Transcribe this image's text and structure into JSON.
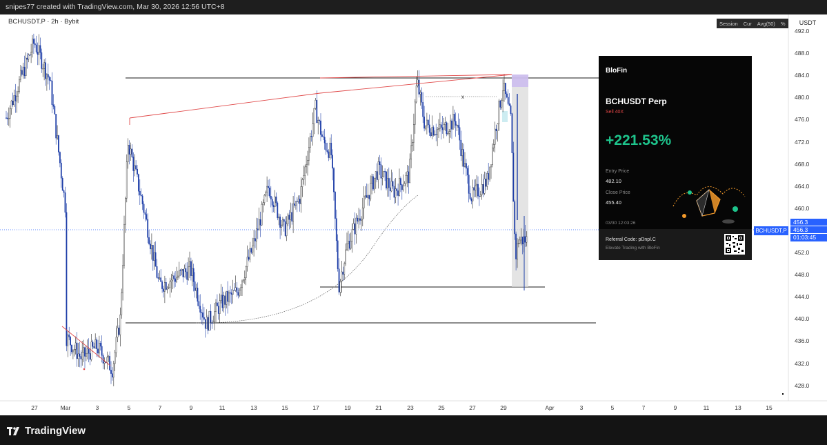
{
  "header": {
    "credit": "snipes77 created with TradingView.com, Mar 30, 2026 12:56 UTC+8"
  },
  "chart": {
    "symbol_label": "BCHUSDT.P · 2h · Bybit",
    "toolbar": [
      "Session",
      "Cur",
      "Avg(50)",
      "%"
    ],
    "currency": "USDT",
    "y_ticks": [
      "492.0",
      "488.0",
      "484.0",
      "480.0",
      "476.0",
      "472.0",
      "468.0",
      "464.0",
      "460.0",
      "456.0",
      "452.0",
      "448.0",
      "444.0",
      "440.0",
      "436.0",
      "432.0",
      "428.0"
    ],
    "x_ticks": [
      "27",
      "Mar",
      "3",
      "5",
      "7",
      "9",
      "11",
      "13",
      "15",
      "17",
      "19",
      "21",
      "23",
      "25",
      "27",
      "29",
      "Apr",
      "3",
      "5",
      "7",
      "9",
      "11",
      "13",
      "15"
    ],
    "last_price": "456.3",
    "last_price_repeat": "456.3",
    "countdown": "01:03:45",
    "symbol_tag": "BCHUSDT.P",
    "marker_label": "x",
    "colors": {
      "candle": "#2a2a2a",
      "up_line": "#1e3fa8",
      "trendline": "#e04a4a",
      "level": "#1a1a1a",
      "price": "#2962ff"
    }
  },
  "chart_data": {
    "type": "candlestick",
    "title": "BCHUSDT.P · 2h · Bybit",
    "x_axis_ticks": [
      "27",
      "Mar",
      "3",
      "5",
      "7",
      "9",
      "11",
      "13",
      "15",
      "17",
      "19",
      "21",
      "23",
      "25",
      "27",
      "29",
      "Apr",
      "3",
      "5",
      "7",
      "9",
      "11",
      "13",
      "15"
    ],
    "ylim": [
      426,
      494
    ],
    "path": [
      [
        "Feb 25",
        478
      ],
      [
        "Feb 26",
        492
      ],
      [
        "Feb 27",
        485
      ],
      [
        "Feb 28",
        462
      ],
      [
        "Mar 1",
        439
      ],
      [
        "Mar 2",
        435
      ],
      [
        "Mar 3",
        437
      ],
      [
        "Mar 4",
        433
      ],
      [
        "Mar 4.5",
        442
      ],
      [
        "Mar 5",
        474
      ],
      [
        "Mar 6",
        462
      ],
      [
        "Mar 7",
        448
      ],
      [
        "Mar 9",
        451
      ],
      [
        "Mar 10",
        441
      ],
      [
        "Mar 11",
        445
      ],
      [
        "Mar 12",
        447
      ],
      [
        "Mar 13",
        455
      ],
      [
        "Mar 14",
        466
      ],
      [
        "Mar 15",
        458
      ],
      [
        "Mar 16",
        464
      ],
      [
        "Mar 17",
        480
      ],
      [
        "Mar 17.5",
        474
      ],
      [
        "Mar 18",
        472
      ],
      [
        "Mar 18.5",
        448
      ],
      [
        "Mar 19",
        455
      ],
      [
        "Mar 20",
        462
      ],
      [
        "Mar 21",
        469
      ],
      [
        "Mar 22",
        465
      ],
      [
        "Mar 23",
        468
      ],
      [
        "Mar 23.5",
        485
      ],
      [
        "Mar 24",
        477
      ],
      [
        "Mar 25",
        476
      ],
      [
        "Mar 26",
        478
      ],
      [
        "Mar 26.5",
        470
      ],
      [
        "Mar 27",
        464
      ],
      [
        "Mar 28",
        467
      ],
      [
        "Mar 28.5",
        476
      ],
      [
        "Mar 29",
        484
      ],
      [
        "Mar 29.5",
        478
      ],
      [
        "Mar 29.8",
        453
      ],
      [
        "Mar 30",
        456.3
      ]
    ],
    "horizontal_levels": [
      483.6,
      446.2,
      439.4
    ],
    "last_price": 456.3,
    "colors": {
      "body": "#2a2a2a",
      "trendline": "#e04a4a",
      "level": "#1a1a1a",
      "price_line": "#2962ff"
    }
  },
  "promo_card": {
    "brand": "BloFin",
    "pair": "BCHUSDT Perp",
    "side": "Sell 40X",
    "pnl": "+221.53%",
    "entry_label": "Entry Price",
    "entry_value": "482.10",
    "close_label": "Close Price",
    "close_value": "455.40",
    "timestamp": "03/30 12:03:26",
    "referral": "Referral Code: pDnpl.C",
    "tagline": "Elevate Trading with BloFin",
    "colors": {
      "pnl": "#1ec48c",
      "side": "#e24646",
      "accent": "#f39a2b"
    }
  },
  "footer": {
    "logo_text": "TradingView"
  }
}
